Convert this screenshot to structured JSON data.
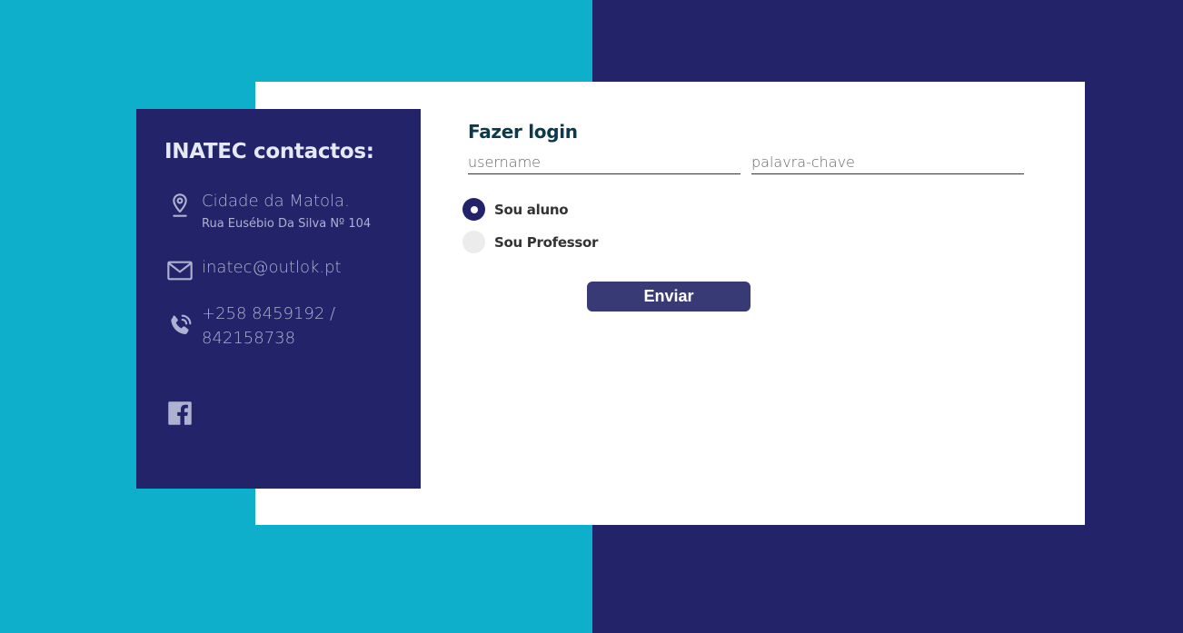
{
  "colors": {
    "background_left": "#0eafcb",
    "background_right": "#222368",
    "card": "#ffffff",
    "contact_panel": "#222368",
    "button": "#383a75",
    "title_dark": "#0b3a4a"
  },
  "contact": {
    "title": "INATEC contactos:",
    "address": {
      "icon": "location-pin-icon",
      "city": "Cidade da Matola.",
      "street": "Rua Eusébio Da Silva Nº 104"
    },
    "email": {
      "icon": "mail-icon",
      "value": "inatec@outlok.pt"
    },
    "phone": {
      "icon": "phone-icon",
      "line1": "+258 8459192 /",
      "line2": "842158738"
    },
    "social": {
      "icon": "facebook-icon"
    }
  },
  "login": {
    "title": "Fazer login",
    "username_placeholder": "username",
    "password_placeholder": "palavra-chave",
    "roles": [
      {
        "label": "Sou aluno",
        "checked": true
      },
      {
        "label": "Sou Professor",
        "checked": false
      }
    ],
    "submit_label": "Enviar"
  }
}
